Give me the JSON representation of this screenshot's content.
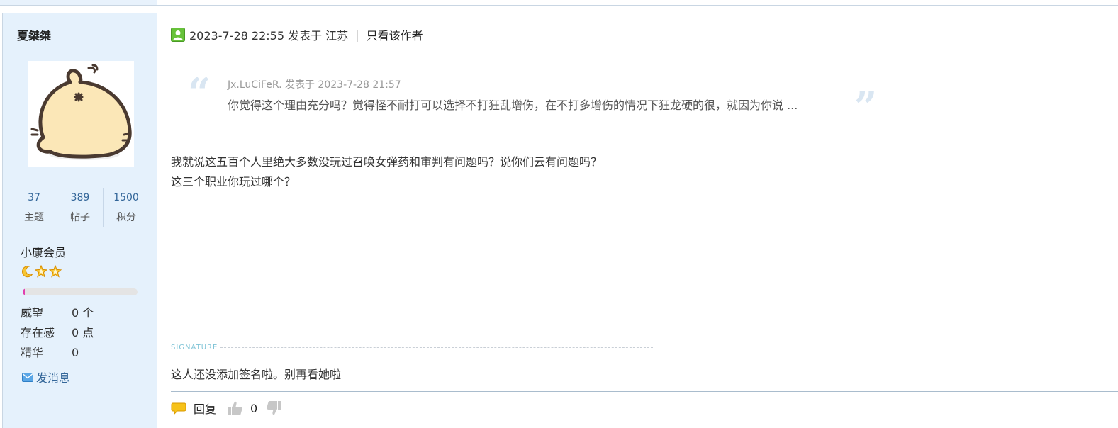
{
  "user": {
    "name": "夏桀桀",
    "stats": [
      {
        "value": "37",
        "label": "主题"
      },
      {
        "value": "389",
        "label": "帖子"
      },
      {
        "value": "1500",
        "label": "积分"
      }
    ],
    "group": "小康会员",
    "level_progress": 0.02,
    "info": [
      {
        "key": "威望",
        "value": "0 个"
      },
      {
        "key": "存在感",
        "value": "0 点"
      },
      {
        "key": "精华",
        "value": "0"
      }
    ],
    "send_message_label": "发消息"
  },
  "post": {
    "time": "2023-7-28 22:55 发表于 江苏",
    "separator": "|",
    "only_author_label": "只看该作者",
    "quote": {
      "author_line": "Jx.LuCiFeR. 发表于 2023-7-28 21:57",
      "text": "你觉得这个理由充分吗？觉得怪不耐打可以选择不打狂乱增伤，在不打多增伤的情况下狂龙硬的很，就因为你说 ..."
    },
    "body_lines": [
      "我就说这五百个人里绝大多数没玩过召唤女弹药和审判有问题吗？说你们云有问题吗？",
      "这三个职业你玩过哪个？"
    ],
    "signature_label": "SIGNATURE",
    "signature_text": "这人还没添加签名啦。别再看她啦",
    "reply_label": "回复",
    "likes": "0"
  },
  "colors": {
    "sidebar_bg": "#e5f1fc",
    "link": "#336699",
    "progress_fill": "#e040b0",
    "signature_label": "#7ec3d6"
  }
}
